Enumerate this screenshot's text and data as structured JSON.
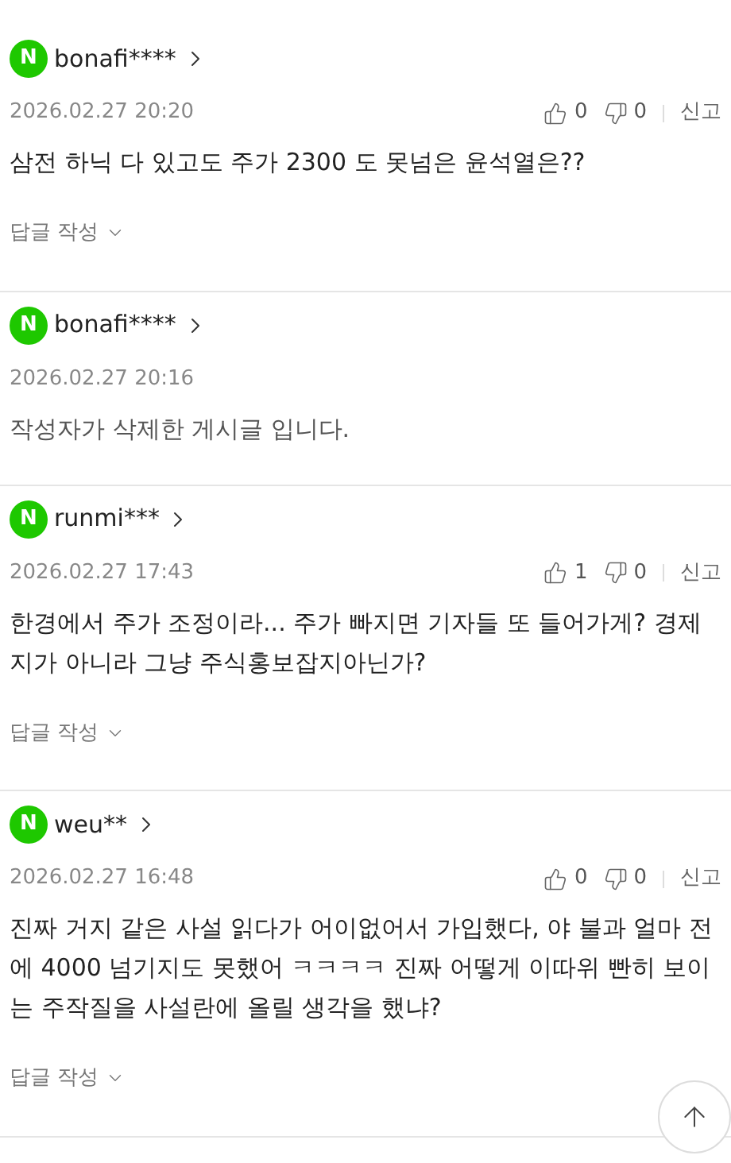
{
  "comments": [
    {
      "kind": "normal",
      "avatar": "N",
      "user": "bonafi****",
      "date": "2026.02.27 20:20",
      "likes": "0",
      "dislikes": "0",
      "report": "신고",
      "body": "삼전 하닉 다 있고도 주가 2300 도 못넘은 윤석열은??",
      "reply": "답글 작성"
    },
    {
      "kind": "deleted",
      "avatar": "N",
      "user": "bonafi****",
      "date": "2026.02.27 20:16",
      "body": "작성자가 삭제한 게시글 입니다."
    },
    {
      "kind": "normal",
      "avatar": "N",
      "user": "runmi***",
      "date": "2026.02.27 17:43",
      "likes": "1",
      "dislikes": "0",
      "report": "신고",
      "body": "한경에서 주가 조정이라... 주가 빠지면 기자들 또 들어가게? 경제지가 아니라 그냥 주식홍보잡지아닌가?",
      "reply": "답글 작성"
    },
    {
      "kind": "normal",
      "avatar": "N",
      "user": "weu**",
      "date": "2026.02.27 16:48",
      "likes": "0",
      "dislikes": "0",
      "report": "신고",
      "body": "진짜 거지 같은 사설 읽다가 어이없어서 가입했다, 야 불과 얼마 전에 4000 넘기지도 못했어 ㅋㅋㅋㅋ 진짜 어떻게 이따위 빤히 보이는 주작질을 사설란에 올릴 생각을 했냐?",
      "reply": "답글 작성"
    }
  ]
}
